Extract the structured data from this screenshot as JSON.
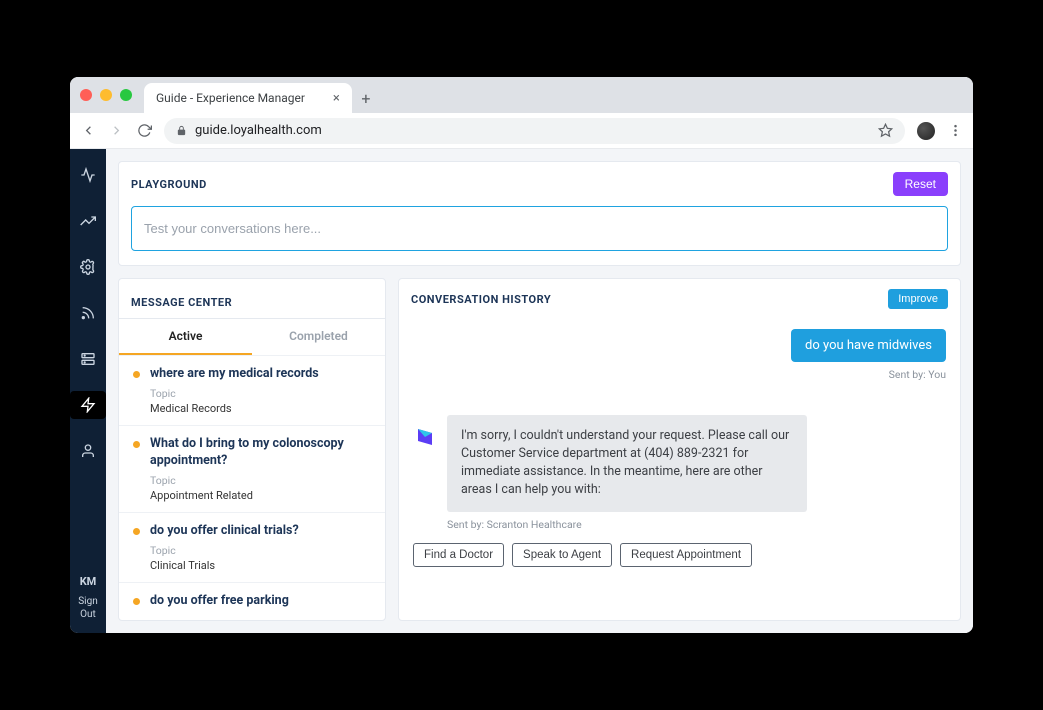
{
  "browser": {
    "tab_title": "Guide - Experience Manager",
    "url": "guide.loyalhealth.com"
  },
  "sidebar": {
    "user_initials": "KM",
    "sign_out": "Sign Out"
  },
  "playground": {
    "title": "PLAYGROUND",
    "reset_label": "Reset",
    "input_placeholder": "Test your conversations here..."
  },
  "message_center": {
    "title": "MESSAGE CENTER",
    "tabs": {
      "active": "Active",
      "completed": "Completed"
    },
    "topic_label": "Topic",
    "items": [
      {
        "question": "where are my medical records",
        "topic": "Medical Records"
      },
      {
        "question": "What do I bring to my colonoscopy appointment?",
        "topic": "Appointment Related"
      },
      {
        "question": "do you offer clinical trials?",
        "topic": "Clinical Trials"
      },
      {
        "question": "do you offer free parking",
        "topic": ""
      }
    ]
  },
  "conversation": {
    "title": "CONVERSATION HISTORY",
    "improve_label": "Improve",
    "user_message": "do you have midwives",
    "user_sent_by": "Sent by: You",
    "bot_message": "I'm sorry, I couldn't understand your request. Please call our Customer Service department at (404) 889-2321 for immediate assistance. In the meantime, here are other areas I can help you with:",
    "bot_sent_by": "Sent by: Scranton Healthcare",
    "actions": [
      "Find a Doctor",
      "Speak to Agent",
      "Request Appointment"
    ]
  }
}
